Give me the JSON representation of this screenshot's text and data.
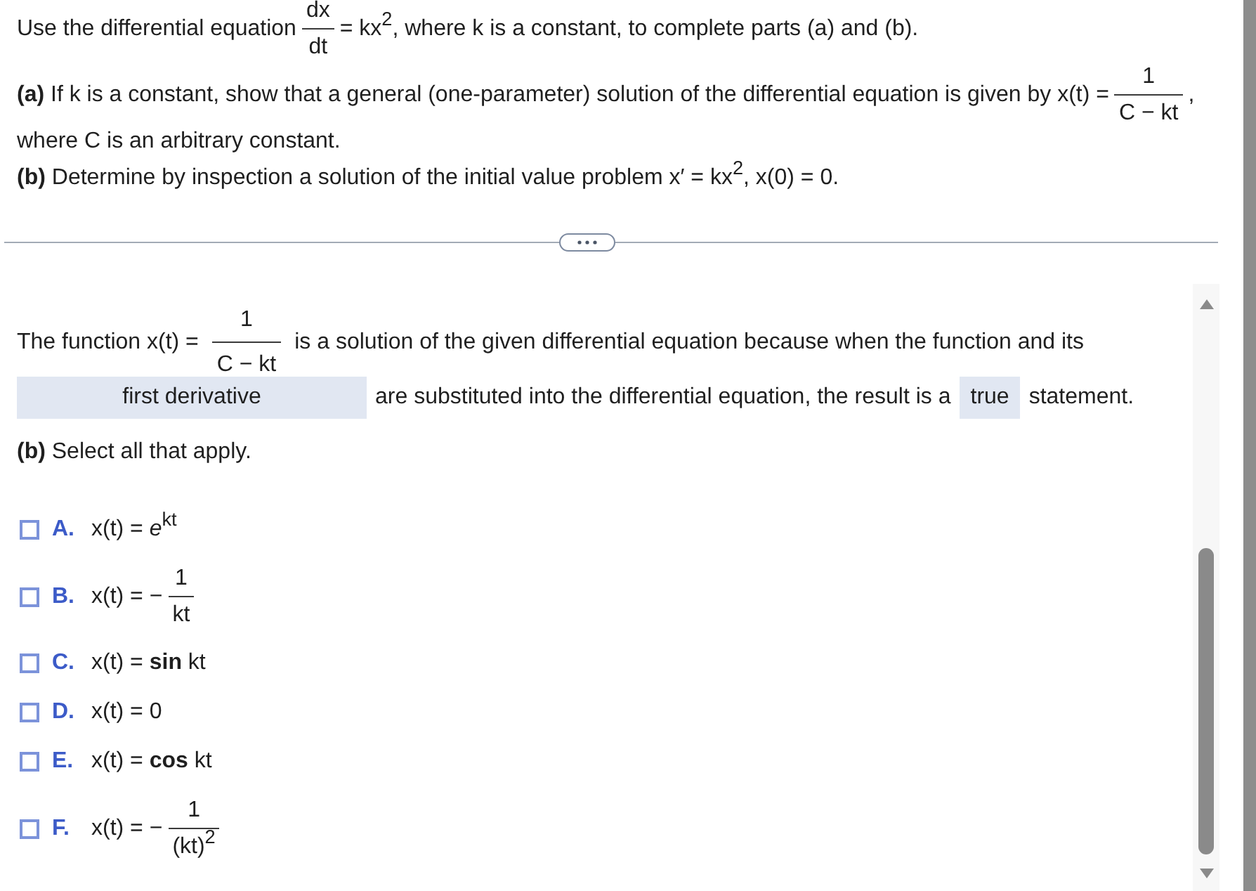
{
  "intro": {
    "segments": [
      {
        "kind": "text",
        "text": "Use the differential equation"
      },
      {
        "kind": "fraction",
        "numerator": "dx",
        "denominator": "dt"
      },
      {
        "kind": "text",
        "text": "= kx$^{2}$, where k is a constant, to complete parts (a) and (b)."
      }
    ]
  },
  "part_a": {
    "segments": [
      {
        "kind": "text",
        "text": "**(a)** If k is a constant, show that a general (one-parameter) solution of the differential equation is given by x(t) ="
      },
      {
        "kind": "fraction",
        "numerator": "1",
        "denominator": "C − kt"
      },
      {
        "kind": "text",
        "text": ","
      }
    ],
    "continuation": "where C is an arbitrary constant."
  },
  "part_b": {
    "text": "**(b)** Determine by inspection a solution of the initial value problem x′ = kx$^{2}$, x(0) = 0."
  },
  "answer_a": {
    "segments": [
      {
        "kind": "text",
        "text": "The function x(t) ="
      },
      {
        "kind": "fraction",
        "numerator": "1",
        "denominator": "C − kt"
      },
      {
        "kind": "text",
        "text": "is a solution of the given differential equation because when the function and its"
      },
      {
        "kind": "blank",
        "value": "first derivative"
      },
      {
        "kind": "text",
        "text": "are substituted into the differential equation, the result is a"
      },
      {
        "kind": "blank",
        "value": "true"
      },
      {
        "kind": "text",
        "text": "statement."
      }
    ]
  },
  "answer_b": {
    "prompt": "**(b)** Select all that apply.",
    "options": [
      {
        "letter": "A.",
        "kind": "text",
        "formula": "x(t) = *e*$^{kt}$",
        "checked": false
      },
      {
        "letter": "B.",
        "kind": "fraction",
        "prefix": "x(t) = −",
        "numerator": "1",
        "denominator": "kt",
        "checked": false
      },
      {
        "letter": "C.",
        "kind": "text",
        "formula": "x(t) = **sin** kt",
        "checked": false
      },
      {
        "letter": "D.",
        "kind": "text",
        "formula": "x(t) = 0",
        "checked": false
      },
      {
        "letter": "E.",
        "kind": "text",
        "formula": "x(t) = **cos** kt",
        "checked": false
      },
      {
        "letter": "F.",
        "kind": "fraction",
        "prefix": "x(t) = −",
        "numerator": "1",
        "denominator": "(kt)$^{2}$",
        "checked": false
      }
    ]
  }
}
